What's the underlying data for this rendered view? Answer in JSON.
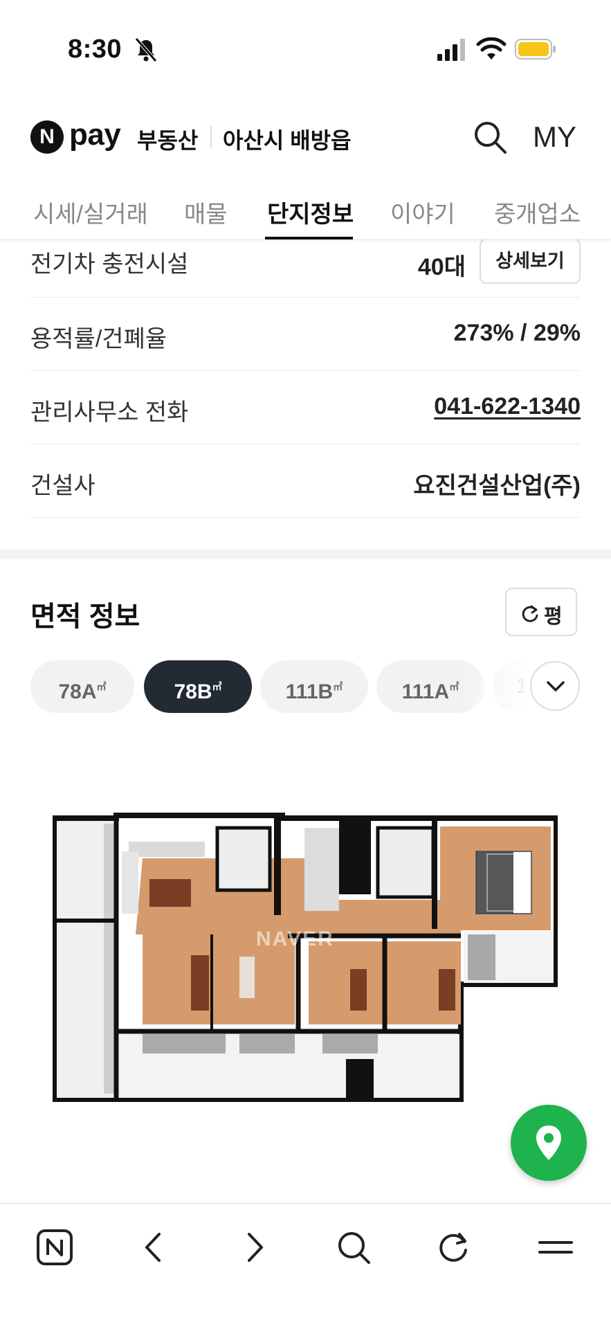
{
  "status_bar": {
    "time": "8:30"
  },
  "header": {
    "logo_letter": "N",
    "logo_text": "pay",
    "service": "부동산",
    "region": "아산시 배방읍",
    "my_label": "MY"
  },
  "tabs": [
    {
      "label": "시세/실거래",
      "active": false
    },
    {
      "label": "매물",
      "active": false
    },
    {
      "label": "단지정보",
      "active": true
    },
    {
      "label": "이야기",
      "active": false
    },
    {
      "label": "중개업소",
      "active": false
    }
  ],
  "info_rows": {
    "ev_charging": {
      "label": "전기차 충전시설",
      "value": "40대",
      "button": "상세보기"
    },
    "floor_ratio": {
      "label": "용적률/건폐율",
      "value": "273% / 29%"
    },
    "office_phone": {
      "label": "관리사무소 전화",
      "value": "041-622-1340"
    },
    "builder": {
      "label": "건설사",
      "value": "요진건설산업(주)"
    }
  },
  "area_info": {
    "title": "면적 정보",
    "unit_toggle": "평",
    "chips": [
      {
        "label": "78A",
        "active": false
      },
      {
        "label": "78B",
        "active": true
      },
      {
        "label": "111B",
        "active": false
      },
      {
        "label": "111A",
        "active": false
      },
      {
        "label": "1",
        "active": false
      }
    ],
    "unit_suffix": "㎡",
    "watermark": "NAVER"
  },
  "colors": {
    "accent_green": "#1fb34d",
    "active_chip": "#222a34",
    "battery": "#f5c518"
  },
  "icons": [
    "bell-slash-icon",
    "signal-icon",
    "wifi-icon",
    "battery-icon",
    "search-icon",
    "refresh-icon",
    "chevron-down-icon",
    "map-pin-icon",
    "naver-n-icon",
    "back-icon",
    "forward-icon",
    "reload-icon",
    "menu-icon"
  ]
}
